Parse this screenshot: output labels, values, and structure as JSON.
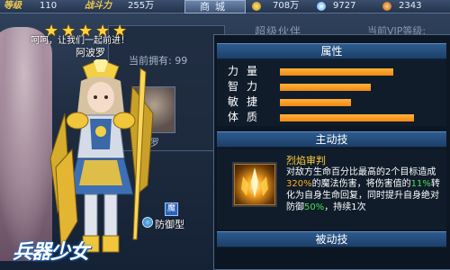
{
  "topbar": {
    "rank_label": "等级",
    "rank_value": "110",
    "power_label": "战斗力",
    "power_value": "255万",
    "shop_label": "商城",
    "gold_value": "708万",
    "gem_value": "9727",
    "stamina_value": "2343"
  },
  "background": {
    "speech": "呵呵，让我们一起前进！",
    "owned_label": "当前拥有:",
    "owned_value": "99",
    "portrait_name": "阿波罗",
    "panel_title": "超级伙伴",
    "vip_label": "当前VIP等级:"
  },
  "hero": {
    "name": "阿波罗",
    "stars": 5,
    "badge": "魔",
    "type": "防御型",
    "logo": "兵器少女"
  },
  "attributes": {
    "title": "属性",
    "items": [
      {
        "label": "力量",
        "value": 0.7
      },
      {
        "label": "智力",
        "value": 0.56
      },
      {
        "label": "敏捷",
        "value": 0.44
      },
      {
        "label": "体质",
        "value": 0.83
      }
    ],
    "bar_color": "#f49a1c"
  },
  "active_skill": {
    "title": "主动技",
    "name": "烈焰审判",
    "desc_1": "对敌方生命百分比最高的2个目标造成",
    "desc_2": "320%",
    "desc_3": "的魔法伤害，将伤害值的",
    "desc_4": "11%",
    "desc_5": "转化为自身生命回复，同时提升自身绝对防御",
    "desc_6": "50%",
    "desc_7": "，持续1次"
  },
  "passive_skill": {
    "title": "被动技"
  }
}
